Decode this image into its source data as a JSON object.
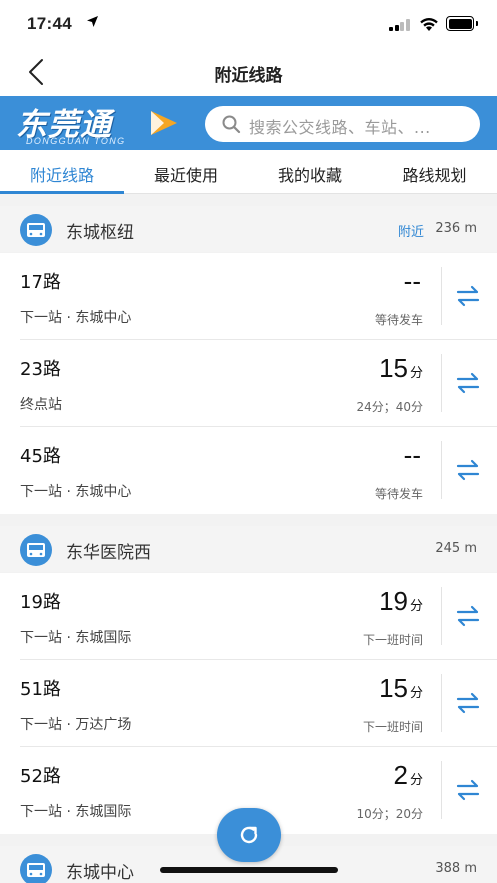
{
  "status_bar": {
    "time": "17:44"
  },
  "nav": {
    "title": "附近线路"
  },
  "brand": {
    "logo_text": "东莞通",
    "logo_subtext": "DONGGUAN TONG"
  },
  "search": {
    "placeholder": "搜索公交线路、车站、..."
  },
  "tabs": [
    {
      "label": "附近线路",
      "active": true
    },
    {
      "label": "最近使用",
      "active": false
    },
    {
      "label": "我的收藏",
      "active": false
    },
    {
      "label": "路线规划",
      "active": false
    }
  ],
  "stops": [
    {
      "name": "东城枢纽",
      "near_label": "附近",
      "distance": "236 m",
      "routes": [
        {
          "name": "17路",
          "next": "下一站 · 东城中心",
          "eta": "--",
          "unit": "",
          "sub": "等待发车"
        },
        {
          "name": "23路",
          "next": "终点站",
          "eta": "15",
          "unit": "分",
          "sub": "24分；40分"
        },
        {
          "name": "45路",
          "next": "下一站 · 东城中心",
          "eta": "--",
          "unit": "",
          "sub": "等待发车"
        }
      ]
    },
    {
      "name": "东华医院西",
      "near_label": "",
      "distance": "245 m",
      "routes": [
        {
          "name": "19路",
          "next": "下一站 · 东城国际",
          "eta": "19",
          "unit": "分",
          "sub": "下一班时间"
        },
        {
          "name": "51路",
          "next": "下一站 · 万达广场",
          "eta": "15",
          "unit": "分",
          "sub": "下一班时间"
        },
        {
          "name": "52路",
          "next": "下一站 · 东城国际",
          "eta": "2",
          "unit": "分",
          "sub": "10分；20分"
        }
      ]
    },
    {
      "name": "东城中心",
      "near_label": "",
      "distance": "388 m",
      "routes": []
    }
  ],
  "colors": {
    "accent": "#2f86d3",
    "brand_bar": "#3b8fd8"
  }
}
